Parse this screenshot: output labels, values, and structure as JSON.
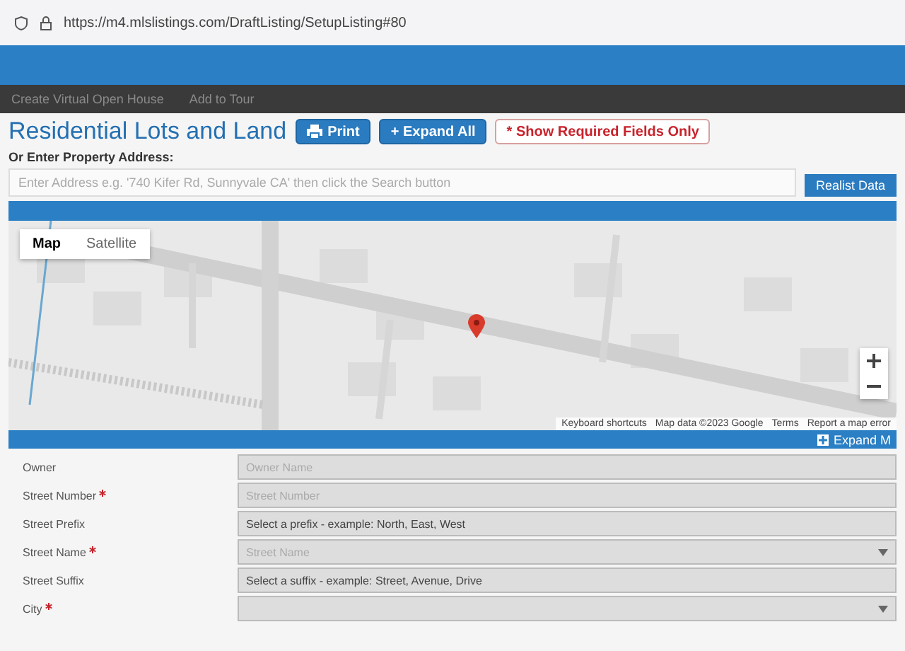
{
  "browser": {
    "url": "https://m4.mlslistings.com/DraftListing/SetupListing#80"
  },
  "nav": {
    "items": [
      "Create Virtual Open House",
      "Add to Tour"
    ]
  },
  "page": {
    "title": "Residential Lots and Land",
    "actions": [
      {
        "kind": "print",
        "label": "Print"
      },
      {
        "kind": "expand",
        "label": "+ Expand All"
      },
      {
        "kind": "required",
        "label": "* Show Required Fields Only"
      }
    ]
  },
  "address": {
    "label": "Or Enter Property Address:",
    "placeholder": "Enter Address e.g. '740 Kifer Rd, Sunnyvale CA' then click the Search button",
    "button": "Realist Data"
  },
  "map": {
    "types": [
      {
        "label": "Map",
        "selected": true
      },
      {
        "label": "Satellite",
        "selected": false
      }
    ],
    "expand": "Expand M",
    "footer": [
      "Keyboard shortcuts",
      "Map data ©2023 Google",
      "Terms",
      "Report a map error"
    ]
  },
  "fields": [
    {
      "label": "Owner",
      "required": false,
      "kind": "input",
      "placeholder": "Owner Name"
    },
    {
      "label": "Street Number",
      "required": true,
      "kind": "input",
      "placeholder": "Street Number"
    },
    {
      "label": "Street Prefix",
      "required": false,
      "kind": "select",
      "value": "Select a prefix - example: North, East, West"
    },
    {
      "label": "Street Name",
      "required": true,
      "kind": "combo",
      "placeholder": "Street Name"
    },
    {
      "label": "Street Suffix",
      "required": false,
      "kind": "select",
      "value": "Select a suffix - example: Street, Avenue, Drive"
    },
    {
      "label": "City",
      "required": true,
      "kind": "combo"
    }
  ]
}
